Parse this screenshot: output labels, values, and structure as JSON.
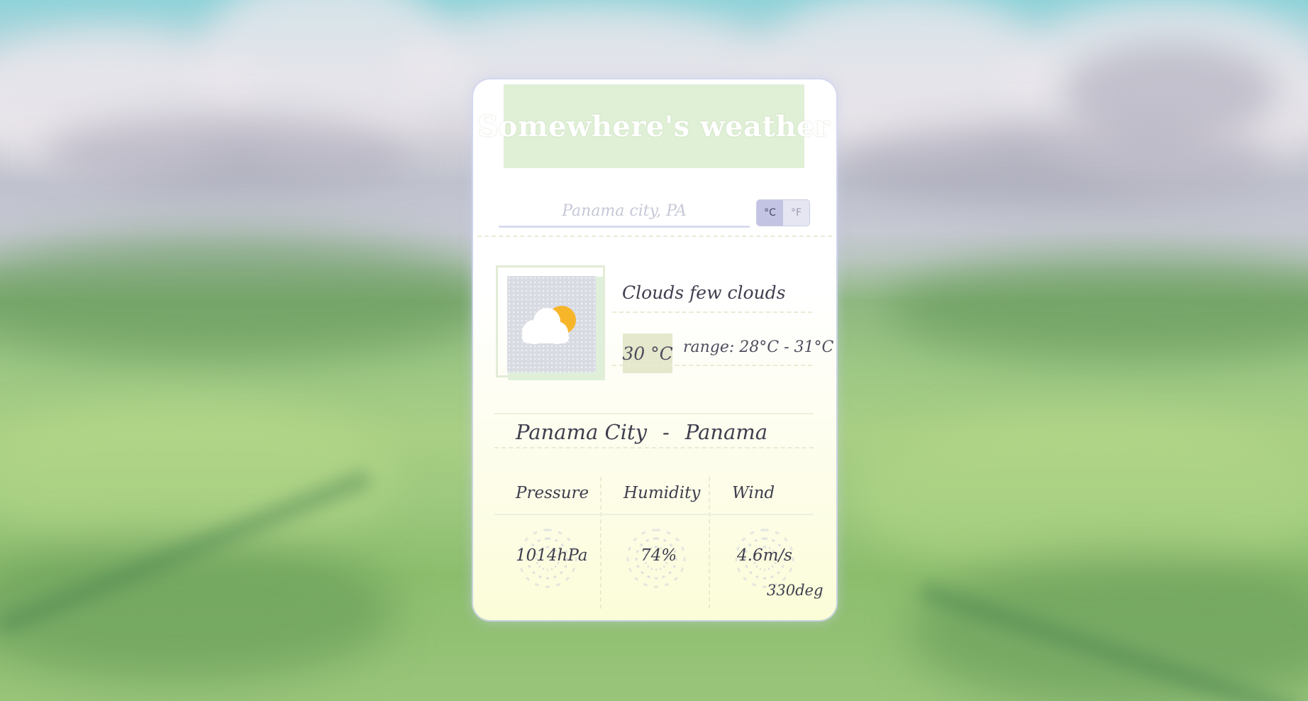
{
  "app": {
    "title": "Somewhere's weather"
  },
  "search": {
    "placeholder": "Panama city, PA",
    "value": ""
  },
  "units": {
    "celsius_label": "°C",
    "fahrenheit_label": "°F",
    "selected": "celsius"
  },
  "current": {
    "icon": "few-clouds-day-icon",
    "description": "Clouds few clouds",
    "temperature": "30 °C",
    "range": "range: 28°C - 31°C"
  },
  "location": {
    "city": "Panama City",
    "separator": "-",
    "country": "Panama"
  },
  "stats": {
    "pressure": {
      "label": "Pressure",
      "value": "1014hPa"
    },
    "humidity": {
      "label": "Humidity",
      "value": "74%"
    },
    "wind": {
      "label": "Wind",
      "value": "4.6m/s",
      "direction": "330deg"
    }
  },
  "colors": {
    "title_bg": "#e0f0d6",
    "unit_active": "#c3c4e3",
    "sun": "#f7b52a",
    "cloud": "#ffffff"
  }
}
